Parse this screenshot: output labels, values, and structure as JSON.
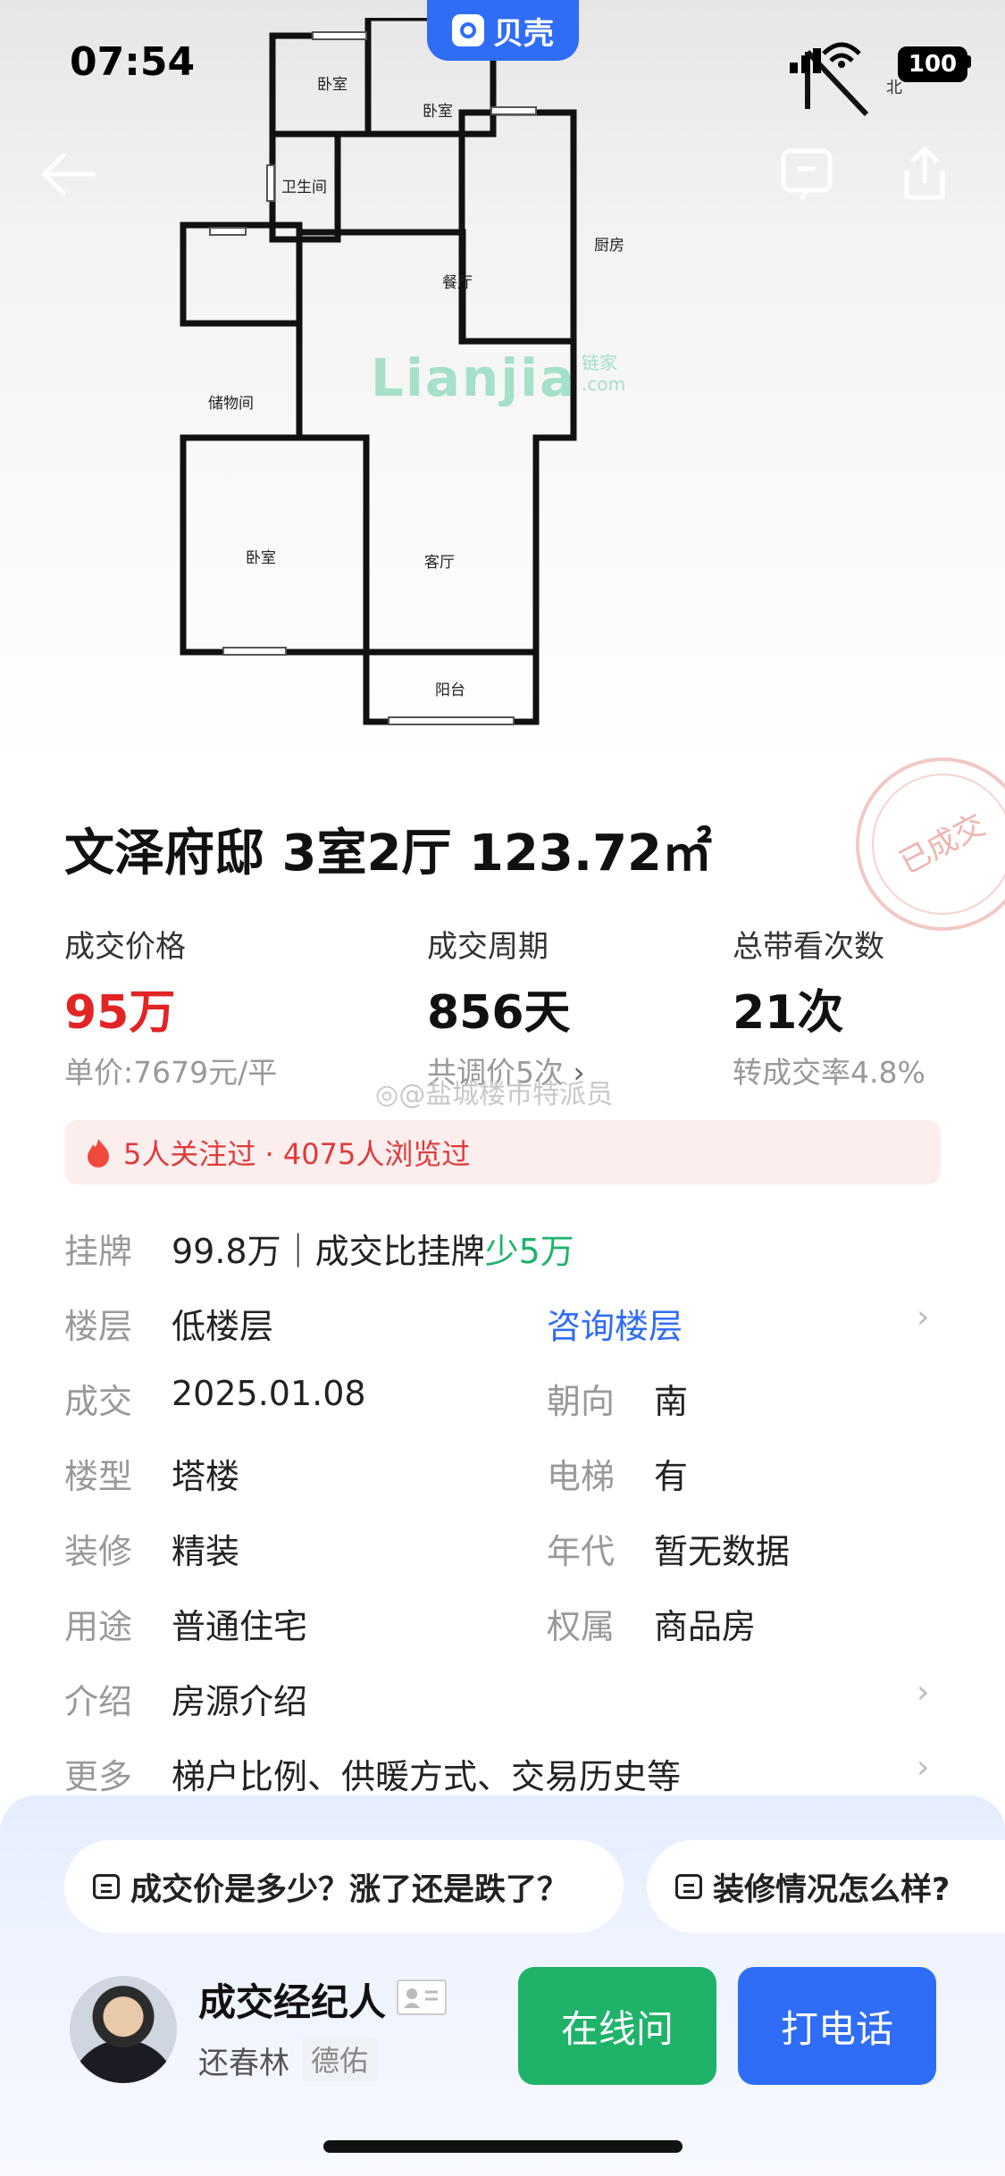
{
  "status_bar": {
    "time": "07:54",
    "battery": "100"
  },
  "brand": {
    "name": "贝壳"
  },
  "floor_plan": {
    "compass": "北",
    "watermark": "Lianjia",
    "watermark_cn": "链家",
    "watermark_com": ".com",
    "rooms": [
      "卧室",
      "卧室",
      "卫生间",
      "餐厅",
      "厨房",
      "储物间",
      "卧室",
      "客厅",
      "阳台"
    ]
  },
  "listing": {
    "title": "文泽府邸 3室2厅 123.72㎡",
    "stamp": "已成交",
    "stats": [
      {
        "label": "成交价格",
        "value": "95万",
        "sub": "单价:7679元/平"
      },
      {
        "label": "成交周期",
        "value": "856天",
        "sub": "共调价5次"
      },
      {
        "label": "总带看次数",
        "value": "21次",
        "sub": "转成交率4.8%"
      }
    ],
    "weibo_watermark": "@盐城楼市特派员",
    "hot": "5人关注过 · 4075人浏览过",
    "details": {
      "listing_label": "挂牌",
      "listing_value_prefix": "99.8万｜成交比挂牌",
      "listing_value_diff": "少5万",
      "floor_label": "楼层",
      "floor_value": "低楼层",
      "floor_link": "咨询楼层",
      "deal_label": "成交",
      "deal_value": "2025.01.08",
      "orientation_label": "朝向",
      "orientation_value": "南",
      "building_label": "楼型",
      "building_value": "塔楼",
      "elevator_label": "电梯",
      "elevator_value": "有",
      "decor_label": "装修",
      "decor_value": "精装",
      "year_label": "年代",
      "year_value": "暂无数据",
      "use_label": "用途",
      "use_value": "普通住宅",
      "ownership_label": "权属",
      "ownership_value": "商品房",
      "intro_label": "介绍",
      "intro_value": "房源介绍",
      "more_label": "更多",
      "more_value": "梯户比例、供暖方式、交易历史等"
    }
  },
  "questions": [
    "成交价是多少？涨了还是跌了？",
    "装修情况怎么样?"
  ],
  "agent": {
    "title": "成交经纪人",
    "name": "还春林",
    "company": "德佑"
  },
  "buttons": {
    "online": "在线问",
    "call": "打电话"
  },
  "colors": {
    "price_red": "#e32424",
    "green": "#1fb36a",
    "blue": "#2f6df6",
    "online_btn": "#1fb36a",
    "call_btn": "#2f6df6"
  }
}
